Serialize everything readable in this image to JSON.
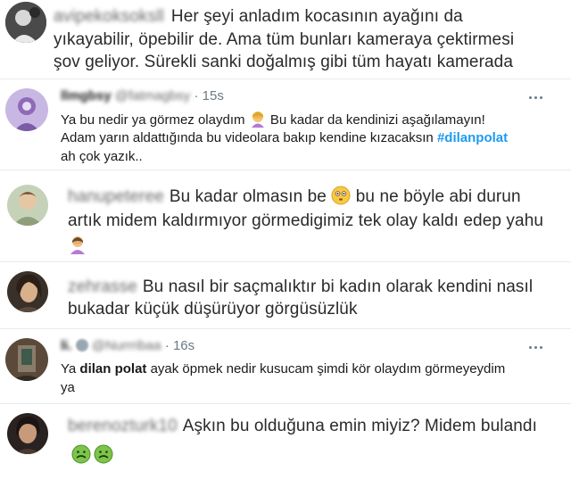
{
  "comments": [
    {
      "username": "avipekoksoksll",
      "lines": [
        "Her şeyi anladım kocasının ayağını da",
        "yıkayabilir, öpebilir de. Ama tüm bunları kameraya çektirmesi",
        "şov geliyor. Sürekli sanki doğalmış gibi tüm hayatı kamerada"
      ]
    },
    {
      "display_name": "llmgbsy",
      "handle": "@fatmagbsy",
      "time": "· 15s",
      "more_icon": "ellipsis-icon",
      "line1_a": "Ya bu nedir ya görmez olaydım",
      "line1_b": "Bu kadar da kendinizi aşağılamayın!",
      "line2_a": "Adam yarın aldattığında bu videolara bakıp kendine kızacaksın",
      "hashtag": "#dilanpolat",
      "line3": "ah çok yazık.."
    },
    {
      "username": "hanupeteree",
      "line1_a": "Bu kadar olmasın be",
      "line1_b": "bu ne böyle abi durun",
      "line2": "artık midem kaldırmıyor görmedigimiz tek olay kaldı edep yahu"
    },
    {
      "username": "zehrasse",
      "line1": "Bu nasıl bir saçmalıktır bi kadın olarak kendini nasıl",
      "line2": "bukadar küçük düşürüyor görgüsüzlük"
    },
    {
      "display_name": "li.",
      "handle": "@Nurrribaa",
      "time": "· 16s",
      "more_icon": "ellipsis-icon",
      "line1_a": "Ya",
      "line1_bold": "dilan polat",
      "line1_b": "ayak öpmek nedir kusucam şimdi kör olaydım görmeyeydim",
      "line2": "ya"
    },
    {
      "username": "berenozturk10",
      "line1": "Aşkın bu olduğuna emin miyiz? Midem bulandı"
    }
  ],
  "colors": {
    "hashtag": "#1d9bf0",
    "meta": "#6b7a86",
    "divider": "#e6ecf0",
    "nausea_emoji": "#7cc44a"
  }
}
